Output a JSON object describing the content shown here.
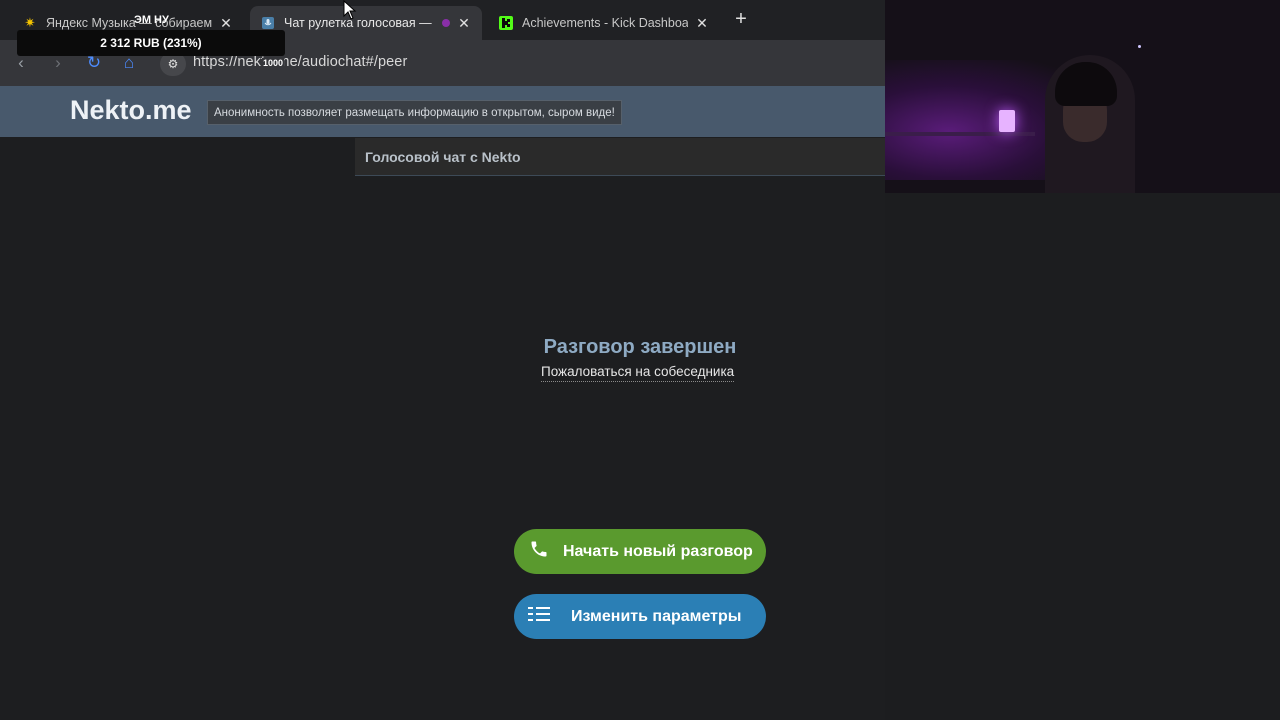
{
  "tabs": [
    {
      "title": "Яндекс Музыка — собираем му",
      "active": false
    },
    {
      "title": "Чат рулетка голосовая —",
      "active": true
    },
    {
      "title": "Achievements - Kick Dashboard",
      "active": false
    }
  ],
  "music_overlay": "ЭМ НУ",
  "price_badge": "2 312 RUB (231%)",
  "address_bar": {
    "url": "https://nekto.me/audiochat#/peer",
    "overlay": "1000"
  },
  "site": {
    "logo": "Nekto.me",
    "tagline": "Анонимность позволяет размещать информацию в открытом, сыром виде!",
    "chat_header": "Голосовой чат с Nekto"
  },
  "conversation": {
    "status": "Разговор завершен",
    "report_link": "Пожаловаться на собеседника"
  },
  "buttons": {
    "start_new": "Начать новый разговор",
    "change_params": "Изменить параметры"
  },
  "colors": {
    "start_button": "#5a9a2e",
    "params_button": "#2b7fb5",
    "header_bar": "#48596c",
    "status_title": "#8eaac3"
  }
}
